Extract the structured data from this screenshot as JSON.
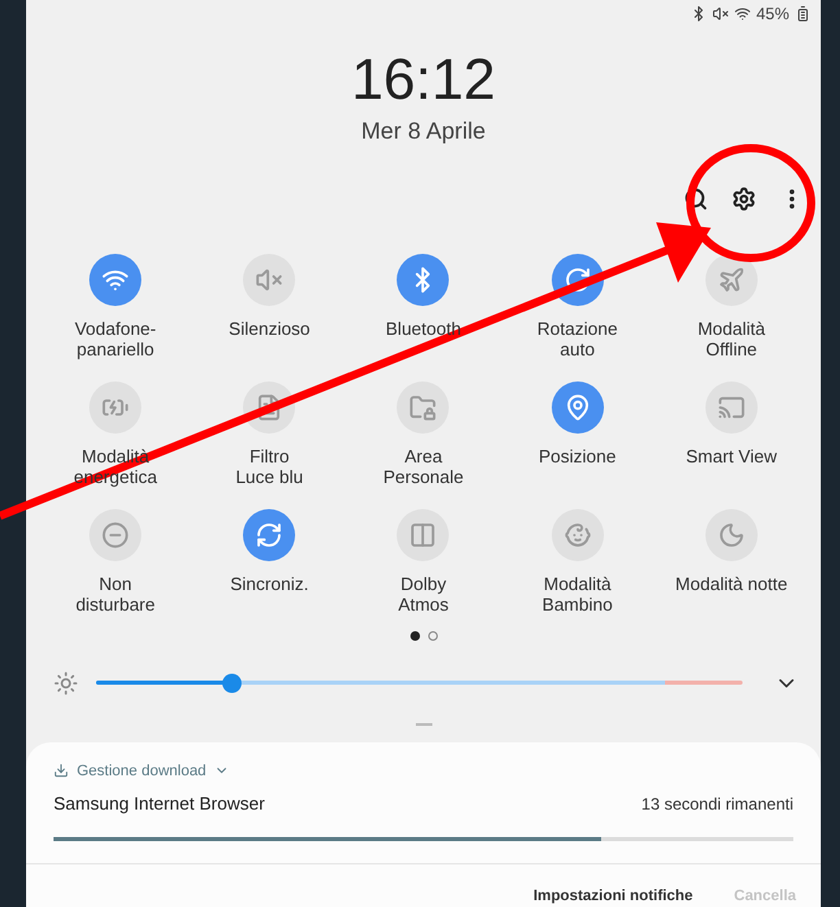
{
  "status_bar": {
    "battery": "45%"
  },
  "clock": {
    "time": "16:12",
    "date": "Mer 8 Aprile"
  },
  "tiles": [
    {
      "label": "Vodafone-\npanariello",
      "on": true
    },
    {
      "label": "Silenzioso",
      "on": false
    },
    {
      "label": "Bluetooth",
      "on": true
    },
    {
      "label": "Rotazione\nauto",
      "on": true
    },
    {
      "label": "Modalità\nOffline",
      "on": false
    },
    {
      "label": "Modalità\nenergetica",
      "on": false
    },
    {
      "label": "Filtro\nLuce blu",
      "on": false
    },
    {
      "label": "Area\nPersonale",
      "on": false
    },
    {
      "label": "Posizione",
      "on": true
    },
    {
      "label": "Smart View",
      "on": false
    },
    {
      "label": "Non\ndisturbare",
      "on": false
    },
    {
      "label": "Sincroniz.",
      "on": true
    },
    {
      "label": "Dolby\nAtmos",
      "on": false
    },
    {
      "label": "Modalità\nBambino",
      "on": false
    },
    {
      "label": "Modalità notte",
      "on": false
    }
  ],
  "pages": [
    {
      "selected": true
    },
    {
      "selected": false
    }
  ],
  "brightness": {
    "level": 0.21
  },
  "notification": {
    "app": "Gestione download",
    "title": "Samsung Internet Browser",
    "time_left": "13 secondi rimanenti",
    "progress": {
      "level": 0.74
    },
    "actions": [
      {
        "label": "Impostazioni notifiche",
        "disabled": false
      },
      {
        "label": "Cancella",
        "disabled": true
      }
    ]
  }
}
